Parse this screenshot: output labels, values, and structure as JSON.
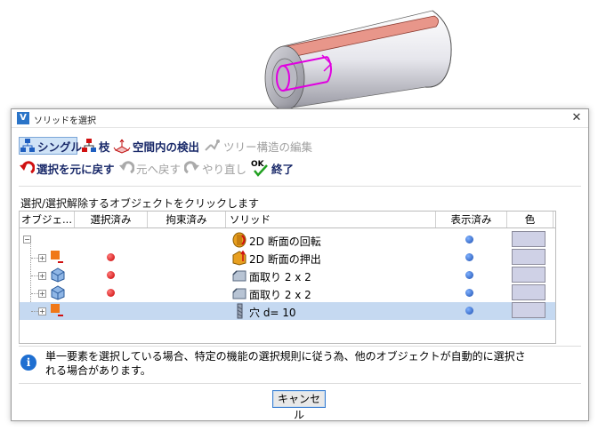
{
  "dialog": {
    "title": "ソリッドを選択",
    "close_glyph": "✕"
  },
  "toolbar": {
    "single_label": "シングル",
    "branch_label": "枝",
    "spatial_label": "空間内の検出",
    "tree_edit_label": "ツリー構造の編集",
    "revert_label": "選択を元に戻す",
    "undo_label": "元へ戻す",
    "redo_label": "やり直し",
    "finish_label": "終了",
    "ok_text": "OK"
  },
  "instruction": "選択/選択解除するオブジェクトをクリックします",
  "table": {
    "columns": [
      "オブジェ...",
      "選択済み",
      "拘束済み",
      "ソリッド",
      "表示済み",
      "色"
    ],
    "rows": [
      {
        "toggle": "−",
        "selected": false,
        "solid": "2D 断面の回転",
        "feature_icon": "revolve-icon",
        "visible": true,
        "color": "#cfd1e6"
      },
      {
        "toggle": "+",
        "selected": true,
        "solid": "2D 断面の押出",
        "feature_icon": "extrude-icon",
        "visible": true,
        "color": "#cfd1e6"
      },
      {
        "toggle": "+",
        "selected": true,
        "solid": "面取り 2 x 2",
        "feature_icon": "chamfer-icon",
        "visible": true,
        "color": "#cfd1e6"
      },
      {
        "toggle": "+",
        "selected": true,
        "solid": "面取り 2 x 2",
        "feature_icon": "chamfer-icon",
        "visible": true,
        "color": "#cfd1e6"
      },
      {
        "toggle": "+",
        "selected": false,
        "solid": "穴 d= 10",
        "feature_icon": "hole-drill-icon",
        "visible": true,
        "color": "#cfd1e6",
        "row_selected": true
      }
    ]
  },
  "info_text": "単一要素を選択している場合、特定の機能の選択規則に従う為、他のオブジェクトが自動的に選択される場合があります。",
  "cancel_label": "キャンセル"
}
